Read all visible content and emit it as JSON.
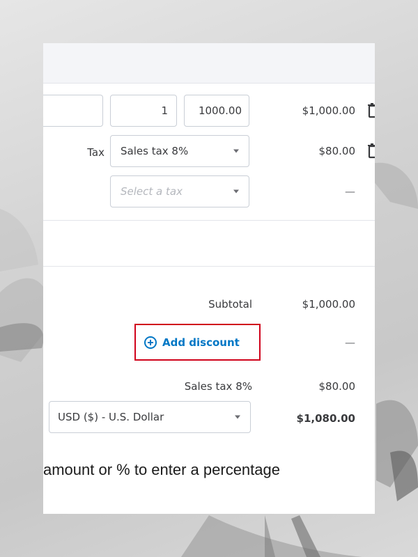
{
  "lines": [
    {
      "qty": "1",
      "rate": "1000.00",
      "amount": "$1,000.00"
    },
    {
      "tax_label": "Tax",
      "tax_value": "Sales tax 8%",
      "amount": "$80.00"
    },
    {
      "tax_placeholder": "Select a tax",
      "amount": "—"
    }
  ],
  "totals": {
    "subtotal_label": "Subtotal",
    "subtotal_value": "$1,000.00",
    "discount_link": "Add discount",
    "discount_value": "—",
    "salestax_label": "Sales tax 8%",
    "salestax_value": "$80.00",
    "currency": "USD ($) - U.S. Dollar",
    "total_value": "$1,080.00"
  },
  "caption": "amount or % to enter a percentage",
  "colors": {
    "accent": "#0077c5",
    "highlight": "#d0021b"
  }
}
